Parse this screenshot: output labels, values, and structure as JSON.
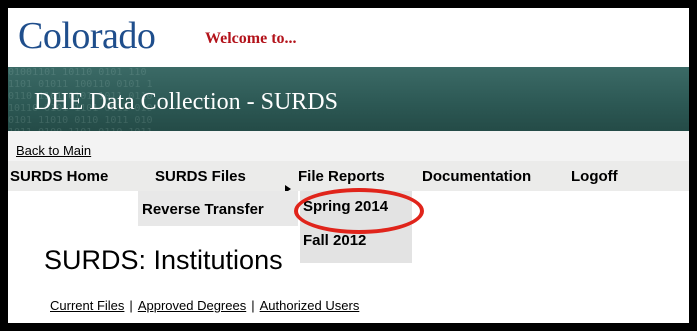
{
  "header": {
    "logo_text": "Colorado",
    "welcome_text": "Welcome to..."
  },
  "banner": {
    "title": "DHE Data Collection - SURDS"
  },
  "back_link": "Back to Main",
  "nav": {
    "surds_home": "SURDS Home",
    "surds_files": "SURDS Files",
    "file_reports": "File Reports",
    "documentation": "Documentation",
    "logoff": "Logoff"
  },
  "submenu": {
    "reverse_transfer": "Reverse Transfer",
    "spring_2014": "Spring 2014",
    "fall_2012": "Fall 2012"
  },
  "page": {
    "title": "SURDS: Institutions"
  },
  "subnav": {
    "current_files": "Current Files",
    "approved_degrees": "Approved Degrees",
    "authorized_users": "Authorized Users",
    "separator": "|"
  },
  "colors": {
    "logo_blue": "#1f4e8c",
    "welcome_red": "#b3131b",
    "banner_green": "#2d5955",
    "highlight_red": "#e0241b"
  },
  "icons": {
    "menu_arrow": "triangle-right-icon",
    "highlight": "red-circle-annotation"
  }
}
